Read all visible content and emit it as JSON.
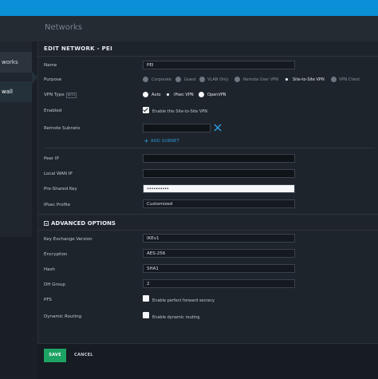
{
  "header": {
    "title": "Networks"
  },
  "leftnav": {
    "items": [
      "works",
      "wall"
    ]
  },
  "form": {
    "section_title": "EDIT NETWORK - PEI",
    "name": {
      "label": "Name",
      "value": "PEI"
    },
    "purpose": {
      "label": "Purpose",
      "options": [
        "Corporate",
        "Guest",
        "VLAN Only",
        "Remote User VPN",
        "Site-to-Site VPN",
        "VPN Client"
      ],
      "selected": "Site-to-Site VPN"
    },
    "vpn_type": {
      "label": "VPN Type",
      "badge": "BETA",
      "options": [
        "Auto",
        "IPsec VPN",
        "OpenVPN"
      ],
      "selected": "IPsec VPN"
    },
    "enabled": {
      "label": "Enabled",
      "checkbox_label": "Enable this Site-to-Site VPN",
      "checked": true
    },
    "remote_subnets": {
      "label": "Remote Subnets",
      "add_label": "ADD SUBNET"
    },
    "peer_ip": {
      "label": "Peer IP"
    },
    "local_wan_ip": {
      "label": "Local WAN IP"
    },
    "pre_shared_key": {
      "label": "Pre-Shared Key",
      "value": "••••••••••"
    },
    "ipsec_profile": {
      "label": "IPsec Profile",
      "value": "Customized"
    },
    "advanced_title": "ADVANCED OPTIONS",
    "key_exchange": {
      "label": "Key Exchange Version",
      "value": "IKEv1"
    },
    "encryption": {
      "label": "Encryption",
      "value": "AES-256"
    },
    "hash": {
      "label": "Hash",
      "value": "SHA1"
    },
    "dh_group": {
      "label": "DH Group",
      "value": "2"
    },
    "pfs": {
      "label": "PFS",
      "checkbox_label": "Enable perfect forward secrecy",
      "checked": false
    },
    "dynamic_routing": {
      "label": "Dynamic Routing",
      "checkbox_label": "Enable dynamic routing",
      "checked": false
    }
  },
  "footer": {
    "save_label": "SAVE",
    "cancel_label": "CANCEL"
  },
  "colors": {
    "accent": "#0b8fd6",
    "save": "#1da363",
    "link": "#2d9ee8"
  }
}
